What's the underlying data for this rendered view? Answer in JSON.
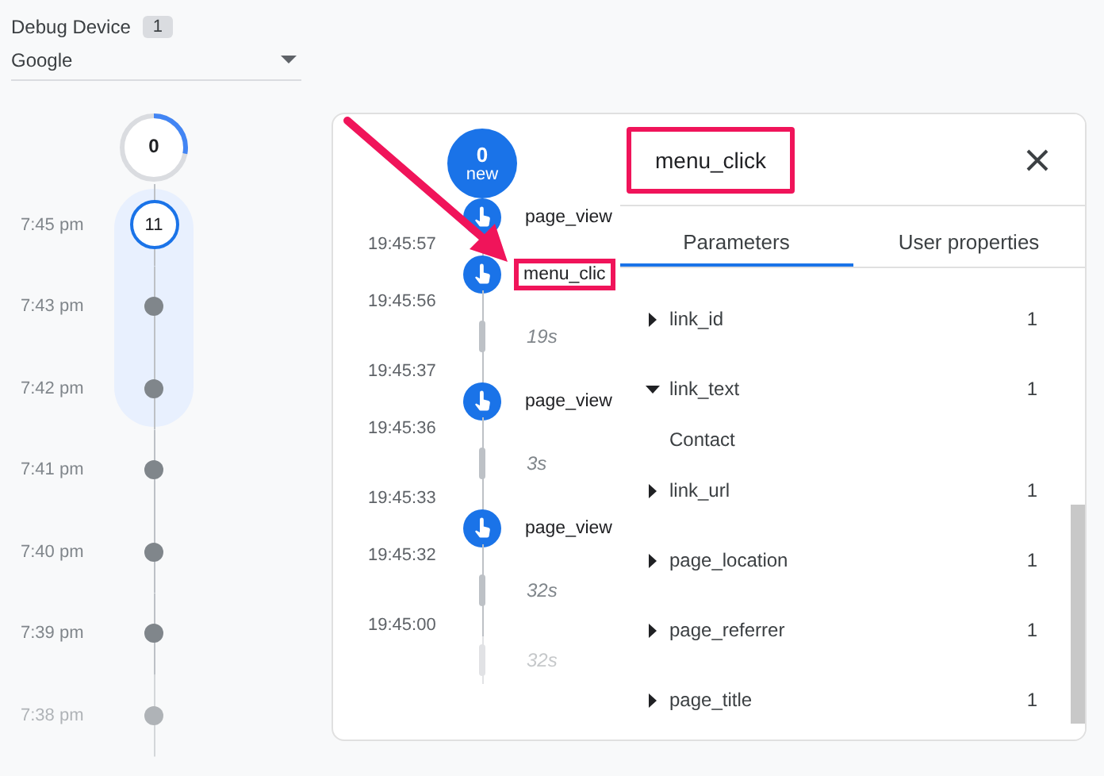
{
  "device": {
    "label": "Debug Device",
    "count": "1",
    "value": "Google"
  },
  "minutes": {
    "pending": {
      "count": "0",
      "level": 0.28
    },
    "items": [
      {
        "time": "7:45 pm",
        "count": "11",
        "highlighted": true,
        "faded": false
      },
      {
        "time": "7:43 pm",
        "highlighted": true,
        "faded": false
      },
      {
        "time": "7:42 pm",
        "highlighted": true,
        "faded": false
      },
      {
        "time": "7:41 pm",
        "highlighted": false,
        "faded": false
      },
      {
        "time": "7:40 pm",
        "highlighted": false,
        "faded": false
      },
      {
        "time": "7:39 pm",
        "highlighted": false,
        "faded": false
      },
      {
        "time": "7:38 pm",
        "highlighted": false,
        "faded": true
      }
    ]
  },
  "stream": {
    "new_badge": {
      "count": "0",
      "label": "new"
    },
    "items": [
      {
        "kind": "event",
        "name": "page_view",
        "highlighted": false
      },
      {
        "kind": "time",
        "text": "19:45:57"
      },
      {
        "kind": "event",
        "name": "menu_clic",
        "highlighted": true
      },
      {
        "kind": "time",
        "text": "19:45:56"
      },
      {
        "kind": "gap",
        "duration": "19s",
        "faded": false
      },
      {
        "kind": "time",
        "text": "19:45:37"
      },
      {
        "kind": "event",
        "name": "page_view",
        "highlighted": false
      },
      {
        "kind": "time",
        "text": "19:45:36"
      },
      {
        "kind": "gap",
        "duration": "3s",
        "faded": false
      },
      {
        "kind": "time",
        "text": "19:45:33"
      },
      {
        "kind": "event",
        "name": "page_view",
        "highlighted": false
      },
      {
        "kind": "time",
        "text": "19:45:32"
      },
      {
        "kind": "gap",
        "duration": "32s",
        "faded": false
      },
      {
        "kind": "time",
        "text": "19:45:00"
      },
      {
        "kind": "gap",
        "duration": "32s",
        "faded": true
      }
    ]
  },
  "detail": {
    "title": "menu_click",
    "highlighted": true,
    "tabs": [
      {
        "label": "Parameters",
        "selected": true
      },
      {
        "label": "User properties",
        "selected": false
      }
    ],
    "parameters": [
      {
        "name": "link_id",
        "value": "1",
        "expanded": false
      },
      {
        "name": "link_text",
        "value": "1",
        "expanded": true,
        "children": [
          {
            "text": "Contact"
          }
        ]
      },
      {
        "name": "link_url",
        "value": "1",
        "expanded": false
      },
      {
        "name": "page_location",
        "value": "1",
        "expanded": false
      },
      {
        "name": "page_referrer",
        "value": "1",
        "expanded": false
      },
      {
        "name": "page_title",
        "value": "1",
        "expanded": false
      }
    ]
  }
}
